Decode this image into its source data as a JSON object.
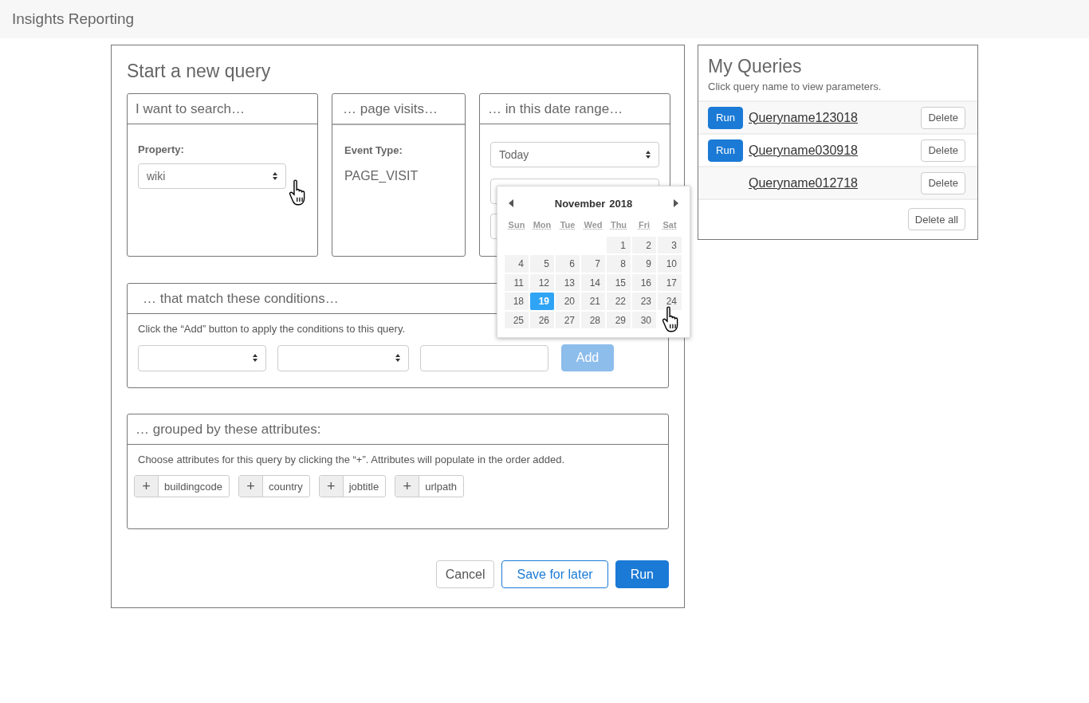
{
  "app_title": "Insights Reporting",
  "query": {
    "title": "Start a new query",
    "search_card": {
      "header": "I want to search…",
      "label": "Property:",
      "select_value": "wiki"
    },
    "event_card": {
      "header": "… page visits…",
      "label": "Event Type:",
      "value": "PAGE_VISIT"
    },
    "date_card": {
      "header": "… in this date range…",
      "select_value": "Today",
      "calendar": {
        "month": "November",
        "year": "2018",
        "weekdays": [
          "Sun",
          "Mon",
          "Tue",
          "Wed",
          "Thu",
          "Fri",
          "Sat"
        ],
        "weeks": [
          [
            {
              "kind": "blank"
            },
            {
              "kind": "blank"
            },
            {
              "kind": "blank"
            },
            {
              "kind": "blank"
            },
            {
              "day": "1",
              "selected": false
            },
            {
              "day": "2",
              "selected": false
            },
            {
              "day": "3",
              "selected": false
            }
          ],
          [
            {
              "day": "4",
              "selected": false
            },
            {
              "day": "5",
              "selected": false
            },
            {
              "day": "6",
              "selected": false
            },
            {
              "day": "7",
              "selected": false
            },
            {
              "day": "8",
              "selected": false
            },
            {
              "day": "9",
              "selected": false
            },
            {
              "day": "10",
              "selected": false
            }
          ],
          [
            {
              "day": "11",
              "selected": false
            },
            {
              "day": "12",
              "selected": false
            },
            {
              "day": "13",
              "selected": false
            },
            {
              "day": "14",
              "selected": false
            },
            {
              "day": "15",
              "selected": false
            },
            {
              "day": "16",
              "selected": false
            },
            {
              "day": "17",
              "selected": false
            }
          ],
          [
            {
              "day": "18",
              "selected": false
            },
            {
              "day": "19",
              "selected": true
            },
            {
              "day": "20",
              "selected": false
            },
            {
              "day": "21",
              "selected": false
            },
            {
              "day": "22",
              "selected": false
            },
            {
              "day": "23",
              "selected": false
            },
            {
              "day": "24",
              "selected": false
            }
          ],
          [
            {
              "day": "25",
              "selected": false
            },
            {
              "day": "26",
              "selected": false
            },
            {
              "day": "27",
              "selected": false
            },
            {
              "day": "28",
              "selected": false
            },
            {
              "day": "29",
              "selected": false
            },
            {
              "day": "30",
              "selected": false
            }
          ]
        ]
      }
    },
    "conditions": {
      "header": "… that match these conditions…",
      "hint": "Click the “Add” button to apply the conditions to this query.",
      "fields": [
        {
          "kind": "select"
        },
        {
          "kind": "select"
        },
        {
          "kind": "text"
        }
      ],
      "add_button": {
        "label": "Add",
        "disabled": true
      }
    },
    "grouping": {
      "header": "… grouped by these attributes:",
      "hint": "Choose attributes for this query by clicking the “+”. Attributes will populate in the order added.",
      "attributes": [
        {
          "plus": "+",
          "name": "buildingcode"
        },
        {
          "plus": "+",
          "name": "country"
        },
        {
          "plus": "+",
          "name": "jobtitle"
        },
        {
          "plus": "+",
          "name": "urlpath"
        }
      ]
    },
    "actions": [
      {
        "label": "Cancel",
        "kind": "default"
      },
      {
        "label": "Save for later",
        "kind": "outline"
      },
      {
        "label": "Run",
        "kind": "primary"
      }
    ]
  },
  "my_queries": {
    "title": "My Queries",
    "subtitle": "Click query name to view parameters.",
    "queries": [
      {
        "run_label": "Run",
        "name": "Queryname123018",
        "delete_label": "Delete"
      },
      {
        "run_label": "Run",
        "name": "Queryname030918",
        "delete_label": "Delete"
      },
      {
        "name": "Queryname012718",
        "delete_label": "Delete"
      }
    ],
    "delete_all": "Delete all"
  }
}
